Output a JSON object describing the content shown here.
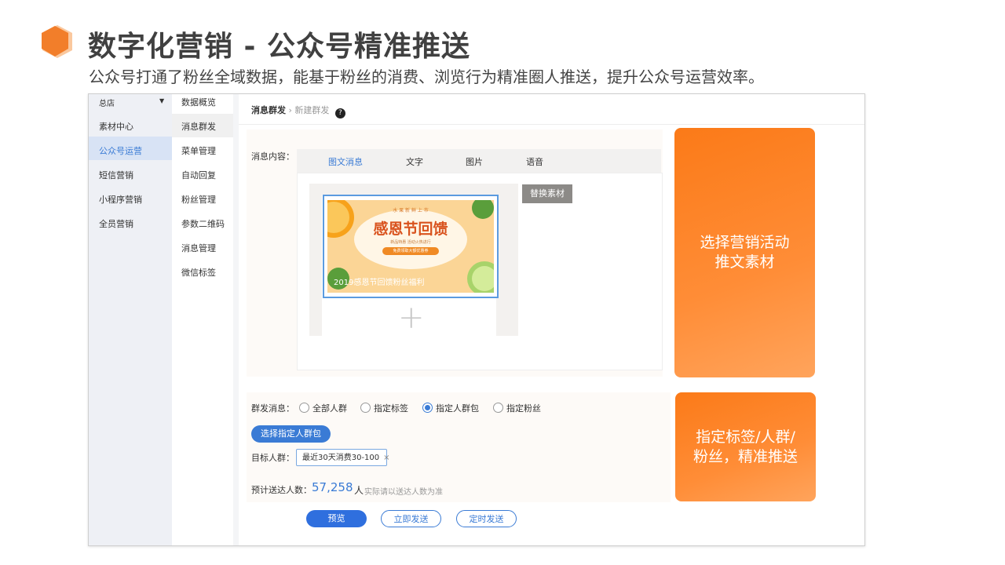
{
  "slide": {
    "title": "数字化营销 - 公众号精准推送",
    "subtitle": "公众号打通了粉丝全域数据，能基于粉丝的消费、浏览行为精准圈人推送，提升公众号运营效率。"
  },
  "sidebar": {
    "store": "总店",
    "items": [
      {
        "label": "素材中心"
      },
      {
        "label": "公众号运营",
        "active": true
      },
      {
        "label": "短信营销"
      },
      {
        "label": "小程序营销"
      },
      {
        "label": "全员营销"
      }
    ]
  },
  "submenu": {
    "items": [
      {
        "label": "数据概览"
      },
      {
        "label": "消息群发",
        "active": true
      },
      {
        "label": "菜单管理"
      },
      {
        "label": "自动回复"
      },
      {
        "label": "粉丝管理"
      },
      {
        "label": "参数二维码"
      },
      {
        "label": "消息管理"
      },
      {
        "label": "微信标签"
      }
    ]
  },
  "breadcrumb": {
    "current": "消息群发",
    "sep": "›",
    "child": "新建群发",
    "help": "?"
  },
  "content": {
    "label": "消息内容：",
    "tabs": [
      "图文消息",
      "文字",
      "图片",
      "语音"
    ],
    "active_tab": 0,
    "replace_button": "替换素材",
    "card": {
      "tagline": "水 果 新 鲜 上 市",
      "headline": "感恩节回馈",
      "subline": "新品特惠 活动火热进行",
      "badge": "免费领取大额优惠券",
      "caption": "2019感恩节回馈粉丝福利"
    },
    "add_icon": "+"
  },
  "audience": {
    "label": "群发消息：",
    "options": [
      "全部人群",
      "指定标签",
      "指定人群包",
      "指定粉丝"
    ],
    "selected": 2,
    "pick_button": "选择指定人群包",
    "target_label": "目标人群：",
    "target_tag": "最近30天消费30-100",
    "target_tag_close": "×",
    "estimate_label": "预计送达人数：",
    "estimate_value": "57,258",
    "estimate_unit": "人",
    "estimate_note": "实际请以送达人数为准"
  },
  "actions": {
    "preview": "预览",
    "send_now": "立即发送",
    "schedule": "定时发送"
  },
  "callouts": {
    "top": [
      "选择营销活动",
      "推文素材"
    ],
    "bottom": [
      "指定标签/人群/",
      "粉丝，精准推送"
    ]
  },
  "colors": {
    "accent_orange": "#fb7a18",
    "accent_blue": "#3a7bd5",
    "title_gray": "#404040"
  },
  "icons": {
    "logo": "hexagon-icon",
    "help": "question-icon",
    "dropdown": "caret-down-icon",
    "add": "plus-icon"
  }
}
